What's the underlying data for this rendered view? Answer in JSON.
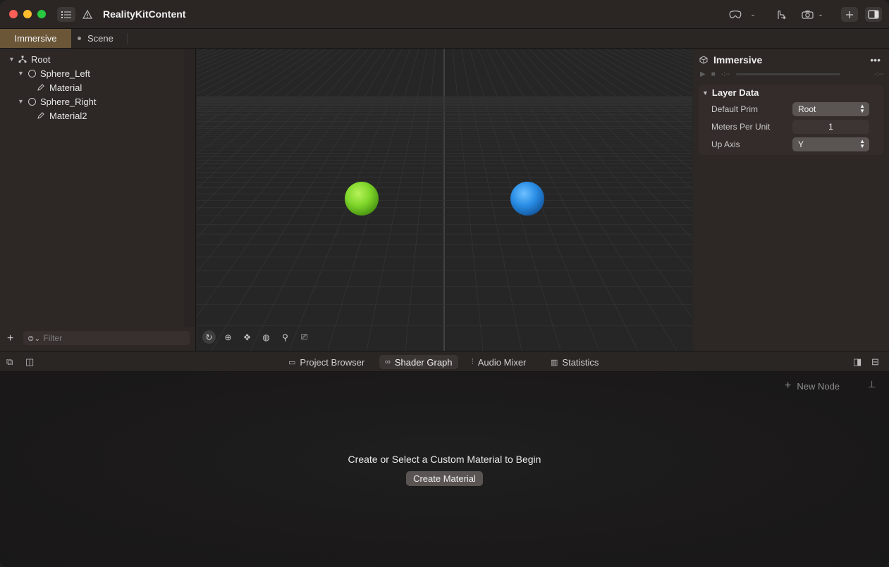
{
  "window": {
    "title": "RealityKitContent"
  },
  "toolbar": {
    "sidebar_toggle_icon": "list-icon",
    "warning_icon": "warning-icon",
    "headset_icon": "headset-icon",
    "gesture_icon": "hand-gesture-icon",
    "camera_icon": "camera-icon",
    "add_icon": "plus-icon",
    "inspector_toggle_icon": "sidebar-right-icon"
  },
  "tabs": [
    {
      "label": "Immersive",
      "active": true
    },
    {
      "label": "Scene",
      "active": false
    }
  ],
  "hierarchy": {
    "items": [
      {
        "label": "Root",
        "icon": "hierarchy-icon",
        "level": 0,
        "expanded": true
      },
      {
        "label": "Sphere_Left",
        "icon": "sphere-icon",
        "level": 1,
        "expanded": true
      },
      {
        "label": "Material",
        "icon": "material-icon",
        "level": 2
      },
      {
        "label": "Sphere_Right",
        "icon": "sphere-icon",
        "level": 1,
        "expanded": true
      },
      {
        "label": "Material2",
        "icon": "material-icon",
        "level": 2
      }
    ],
    "filter_placeholder": "Filter"
  },
  "viewport": {
    "sphere_left_color": "#7fd62a",
    "sphere_right_color": "#2a8ee6",
    "tools": [
      "orbit-icon",
      "pan-icon",
      "move-icon",
      "globe-icon",
      "zoom-icon",
      "camera-record-icon"
    ]
  },
  "inspector": {
    "title": "Immersive",
    "time_start": "-:--",
    "time_end": "-:--",
    "section_title": "Layer Data",
    "properties": [
      {
        "label": "Default Prim",
        "value": "Root",
        "type": "select"
      },
      {
        "label": "Meters Per Unit",
        "value": "1",
        "type": "field"
      },
      {
        "label": "Up Axis",
        "value": "Y",
        "type": "select"
      }
    ]
  },
  "bottom_tabs": [
    {
      "label": "Project Browser",
      "icon": "folder-icon",
      "active": false
    },
    {
      "label": "Shader Graph",
      "icon": "nodes-icon",
      "active": true
    },
    {
      "label": "Audio Mixer",
      "icon": "sliders-icon",
      "active": false
    },
    {
      "label": "Statistics",
      "icon": "bar-chart-icon",
      "active": false
    }
  ],
  "shader_graph": {
    "new_node_label": "New Node",
    "empty_message": "Create or Select a Custom Material to Begin",
    "create_button_label": "Create Material"
  }
}
